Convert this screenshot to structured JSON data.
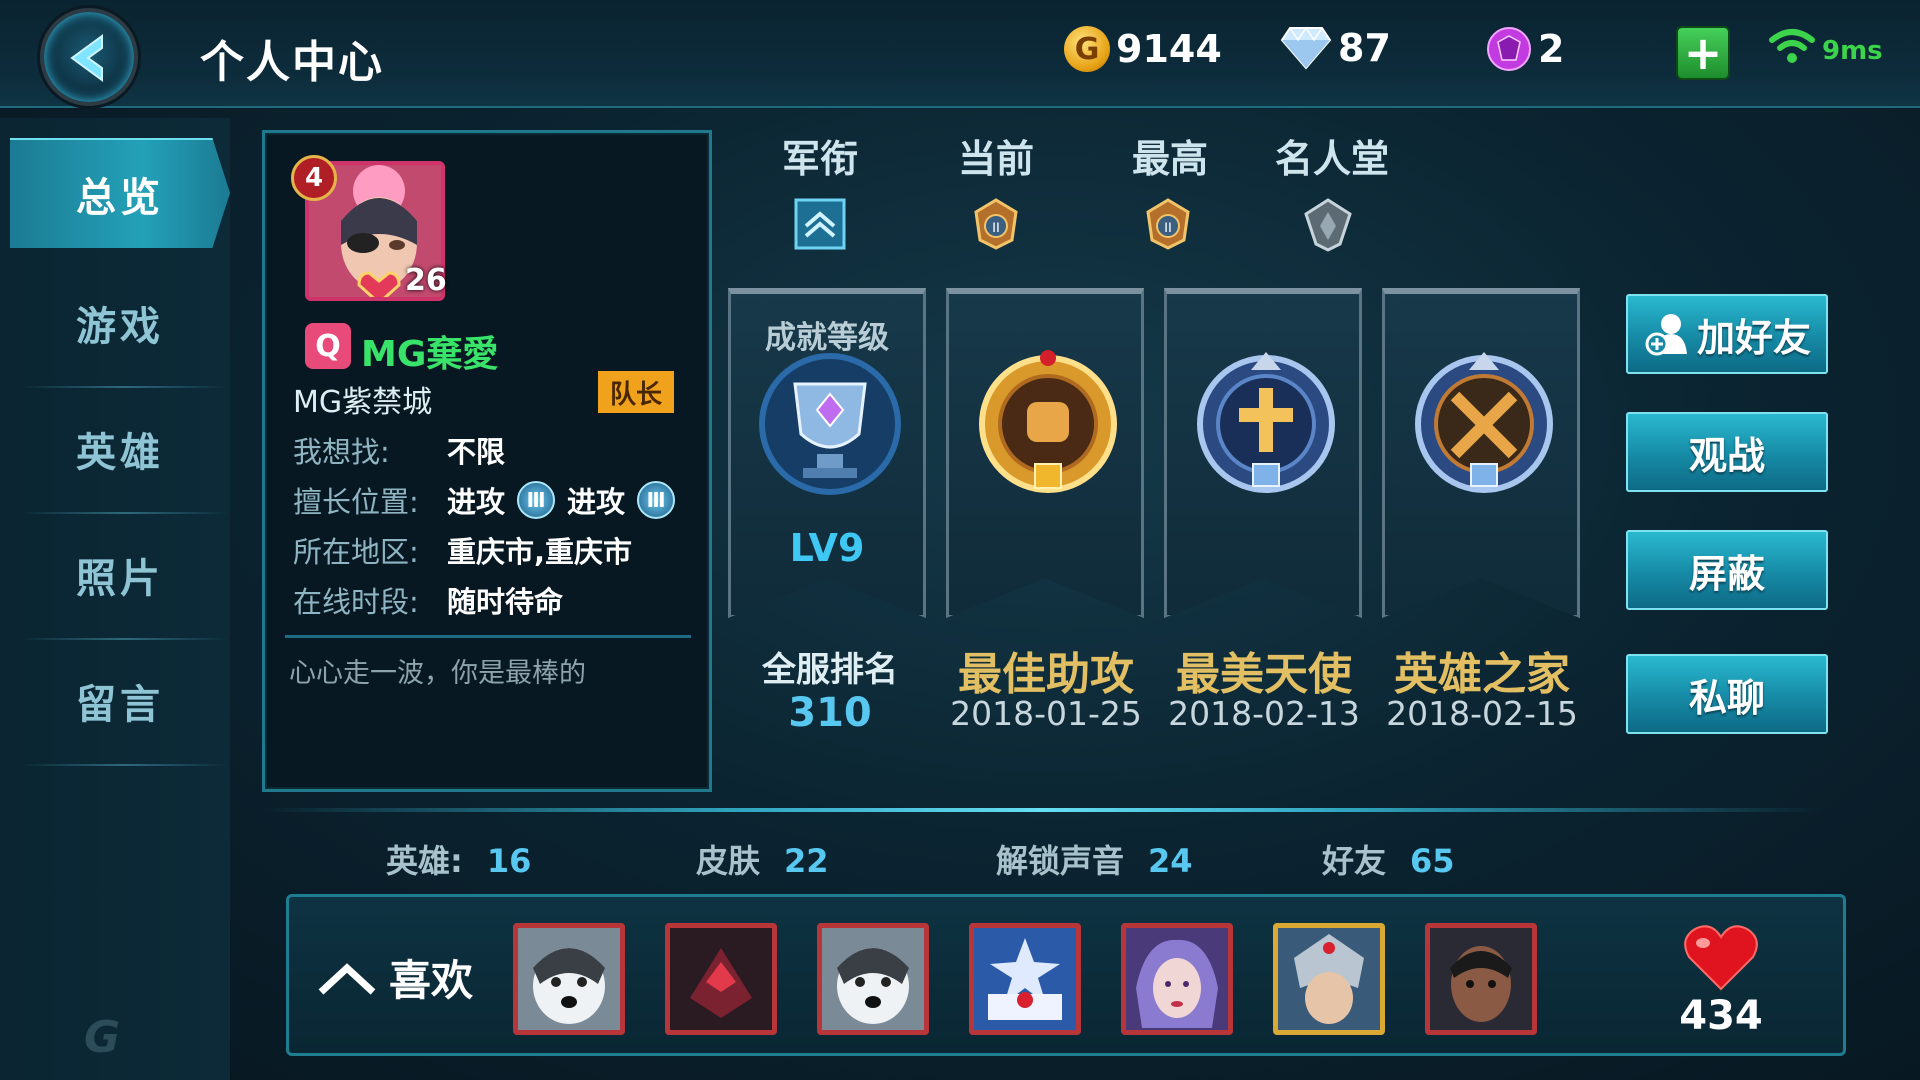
{
  "header": {
    "title": "个人中心",
    "coins": "9144",
    "diamonds": "87",
    "gems": "2",
    "ping": "9ms"
  },
  "sidebar": {
    "items": [
      {
        "label": "总览"
      },
      {
        "label": "游戏"
      },
      {
        "label": "英雄"
      },
      {
        "label": "照片"
      },
      {
        "label": "留言"
      }
    ]
  },
  "profile": {
    "level": "4",
    "stars": "26",
    "username": "MG棄愛",
    "guild": "MG紫禁城",
    "role_badge": "队长",
    "fields": [
      {
        "key": "我想找:",
        "value": "不限"
      },
      {
        "key": "擅长位置:",
        "value1": "进攻",
        "value2": "进攻"
      },
      {
        "key": "所在地区:",
        "value": "重庆市,重庆市"
      },
      {
        "key": "在线时段:",
        "value": "随时待命"
      }
    ],
    "signature": "心心走一波，你是最棒的"
  },
  "ranks": {
    "headers": [
      "军衔",
      "当前",
      "最高",
      "名人堂"
    ]
  },
  "achievements": {
    "level_title": "成就等级",
    "level_value": "LV9",
    "server_rank_label": "全服排名",
    "server_rank_value": "310",
    "medals": [
      {
        "name": "最佳助攻",
        "date": "2018-01-25"
      },
      {
        "name": "最美天使",
        "date": "2018-02-13"
      },
      {
        "name": "英雄之家",
        "date": "2018-02-15"
      }
    ]
  },
  "actions": {
    "add_friend": "加好友",
    "spectate": "观战",
    "block": "屏蔽",
    "private_chat": "私聊"
  },
  "stats": {
    "heroes_label": "英雄:",
    "heroes_value": "16",
    "skins_label": "皮肤",
    "skins_value": "22",
    "voices_label": "解锁声音",
    "voices_value": "24",
    "friends_label": "好友",
    "friends_value": "65"
  },
  "likes": {
    "label": "喜欢",
    "count": "434",
    "heroes": [
      "husky-hero",
      "red-mech-hero",
      "husky-hero",
      "blue-emblem-hero",
      "purple-mage-hero",
      "silver-knight-hero",
      "dark-warrior-hero"
    ]
  }
}
